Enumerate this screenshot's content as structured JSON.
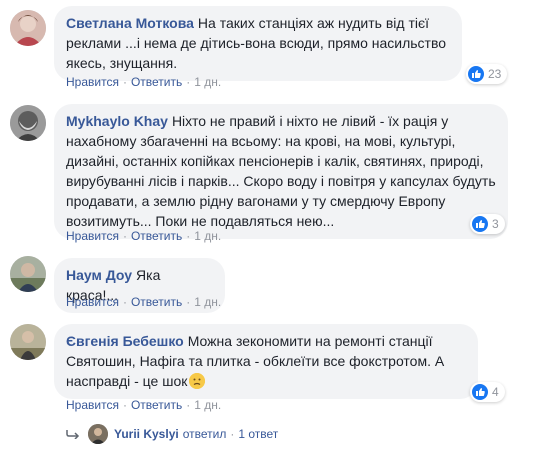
{
  "comments": [
    {
      "author": "Светлана Моткова",
      "text": "На таких станціях аж нудить від тієї реклами ...і нема де дітись-вона всюди, прямо насильство якесь, знущання.",
      "like": "Нравится",
      "reply": "Ответить",
      "time": "1 дн.",
      "reactions": "23"
    },
    {
      "author": "Mykhaylo Khay",
      "text": "Ніхто не правий і ніхто не лівий - їх рація у нахабному збагаченні на всьому: на крові, на мові, культурі, дизайні, останніх копійках пенсіонерів і калік, святинях, природі, вирубуванні лісів і парків... Скоро воду і повітря у капсулах будуть продавати, а землю рідну вагонами у ту смердючу Европу возитимуть... Поки не подавляться нею...",
      "like": "Нравится",
      "reply": "Ответить",
      "time": "1 дн.",
      "reactions": "3"
    },
    {
      "author": "Наум Доу",
      "text": "Яка краса!...",
      "like": "Нравится",
      "reply": "Ответить",
      "time": "1 дн."
    },
    {
      "author": "Євгенія Бебешко",
      "text": "Можна зекономити на ремонті станції Святошин, Нафіга та плитка - обклеїти все фокстротом. А насправді - це шок",
      "like": "Нравится",
      "reply": "Ответить",
      "time": "1 дн.",
      "reactions": "4"
    }
  ],
  "reply_summary": {
    "author": "Yurii Kyslyi",
    "action": "ответил",
    "count": "1 ответ"
  },
  "colors": {
    "link": "#385898",
    "bubble": "#f2f3f5",
    "meta": "#90949c",
    "like_badge": "#1877f2"
  }
}
